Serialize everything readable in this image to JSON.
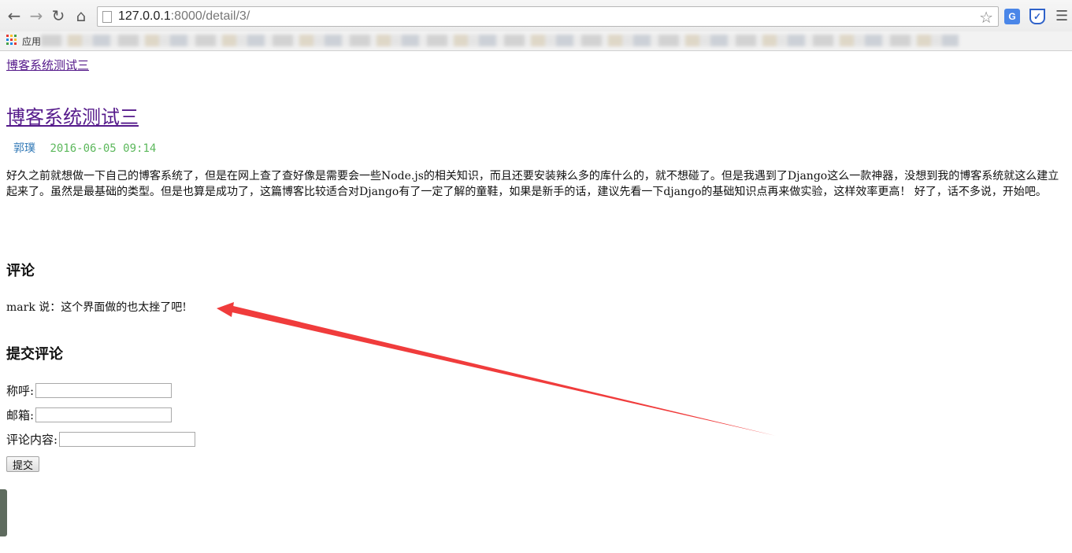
{
  "browser": {
    "url_host": "127.0.0.1",
    "url_rest": ":8000/detail/3/",
    "apps_label": "应用"
  },
  "page": {
    "top_link": "博客系统测试三",
    "post": {
      "title": "博客系统测试三",
      "author": "郭璞",
      "time": "2016-06-05 09:14",
      "body": "好久之前就想做一下自己的博客系统了，但是在网上查了查好像是需要会一些Node.js的相关知识，而且还要安装辣么多的库什么的，就不想碰了。但是我遇到了Django这么一款神器，没想到我的博客系统就这么建立起来了。虽然是最基础的类型。但是也算是成功了，这篇博客比较适合对Django有了一定了解的童鞋，如果是新手的话，建议先看一下django的基础知识点再来做实验，这样效率更高！ 好了，话不多说，开始吧。"
    },
    "comments": {
      "heading": "评论",
      "items": [
        {
          "author": "mark",
          "says": "说：",
          "text": "这个界面做的也太挫了吧!"
        }
      ]
    },
    "form": {
      "heading": "提交评论",
      "name_label": "称呼:",
      "email_label": "邮箱:",
      "content_label": "评论内容:",
      "submit_label": "提交"
    }
  },
  "annotation": {
    "arrow_color": "#f03c3c"
  }
}
